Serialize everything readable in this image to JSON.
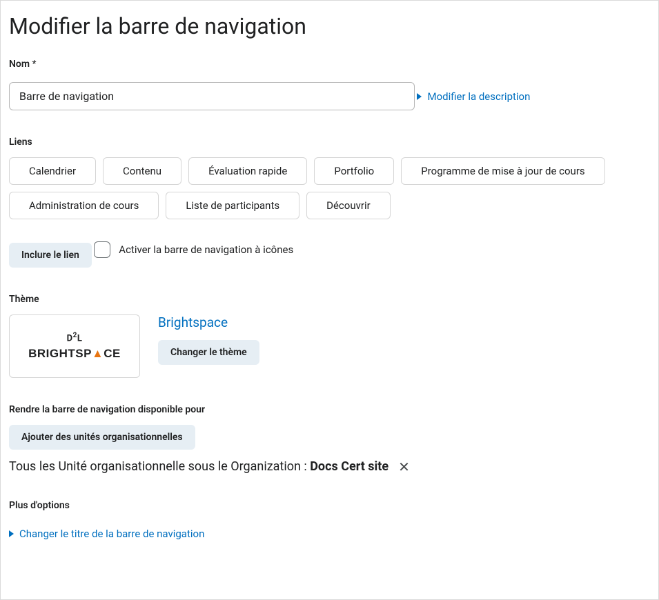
{
  "page": {
    "title": "Modifier la barre de navigation"
  },
  "name": {
    "label": "Nom",
    "value": "Barre de navigation"
  },
  "description": {
    "toggle_label": "Modifier la description"
  },
  "links": {
    "label": "Liens",
    "items": [
      "Calendrier",
      "Contenu",
      "Évaluation rapide",
      "Portfolio",
      "Programme de mise à jour de cours",
      "Administration de cours",
      "Liste de participants",
      "Découvrir"
    ],
    "include_button": "Inclure le lien",
    "icon_navbar_checkbox": "Activer la barre de navigation à icônes"
  },
  "theme": {
    "label": "Thème",
    "name": "Brightspace",
    "change_button": "Changer le thème",
    "logo_d2l": "D2L",
    "logo_brightspace_pre": "BRIGHTSP",
    "logo_brightspace_a": "A",
    "logo_brightspace_post": "CE"
  },
  "availability": {
    "label": "Rendre la barre de navigation disponible pour",
    "add_button": "Ajouter des unités organisationnelles",
    "text_prefix": "Tous les Unité organisationnelle sous le Organization : ",
    "org_name": "Docs Cert site"
  },
  "more_options": {
    "label": "Plus d'options",
    "change_title_link": "Changer le titre de la barre de navigation"
  }
}
